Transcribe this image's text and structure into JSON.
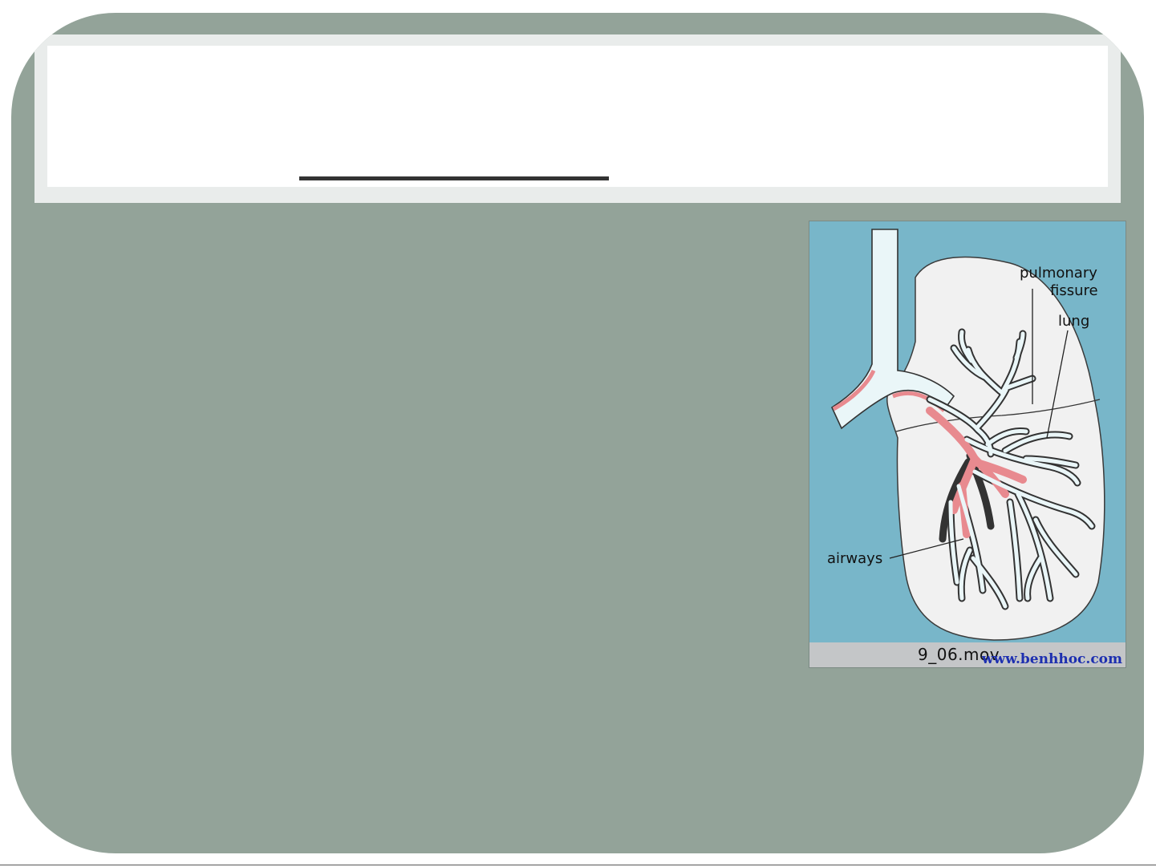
{
  "colors": {
    "slide_background": "#93a399",
    "header_band": "#e9eceb",
    "title_rule": "#333333",
    "diagram_background": "#78b6c9",
    "lung_fill": "#f1f1f1",
    "airway_fill": "#eaf6f8",
    "airway_red": "#e88a8f",
    "caption_bar": "#c4c6c8"
  },
  "figure": {
    "labels": {
      "pulmonary": "pulmonary",
      "fissure": "fissure",
      "lung": "lung",
      "airways": "airways"
    },
    "caption": "9_06.mov",
    "watermark": "www.benhhoc.com"
  }
}
